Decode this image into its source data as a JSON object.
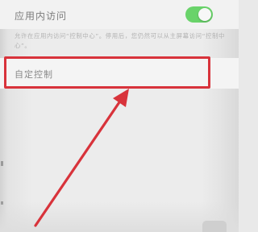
{
  "app_access": {
    "label": "应用内访问",
    "toggle_on": true
  },
  "description": "允许在应用内访问“控制中心”。停用后，您仍然可以从主屏幕访问“控制中心”。",
  "custom_control": {
    "label": "自定控制"
  },
  "annotation": {
    "color": "#d8333b"
  },
  "colors": {
    "toggle_on": "#69d36a"
  }
}
